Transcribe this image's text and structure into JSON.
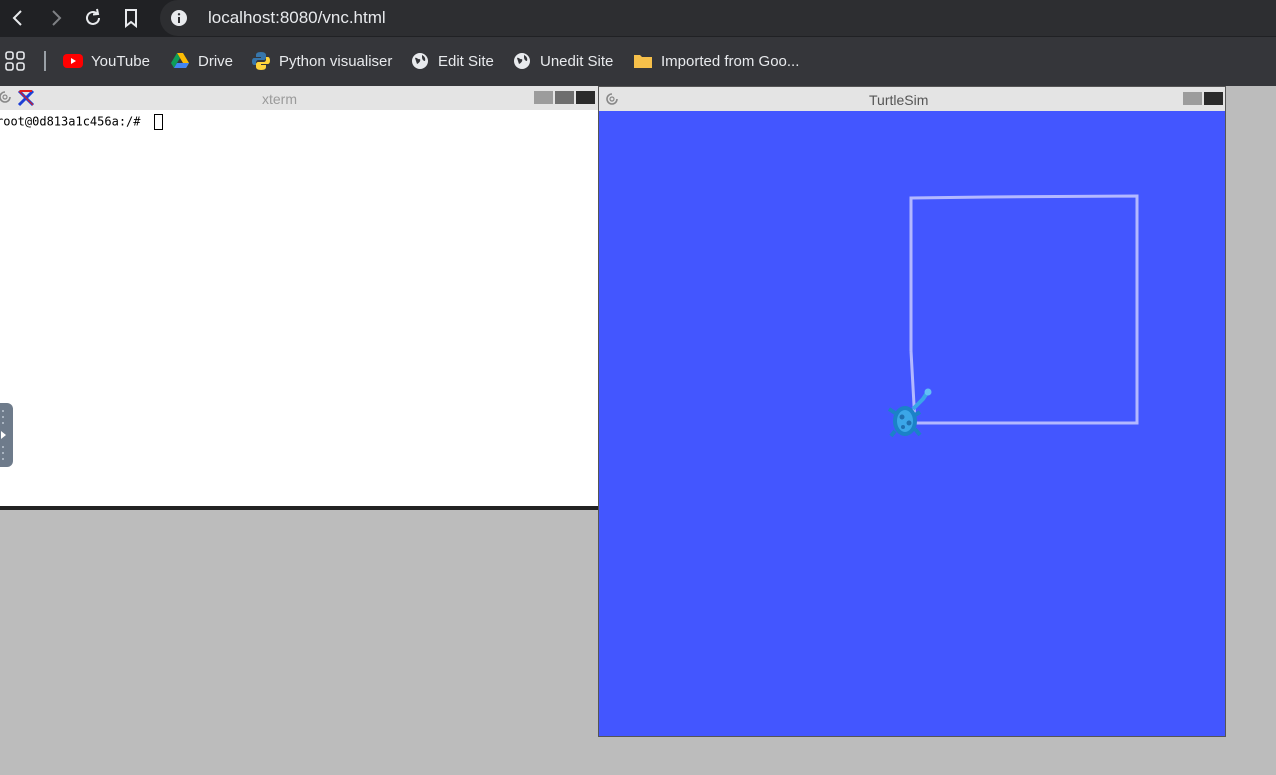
{
  "browser": {
    "url": "localhost:8080/vnc.html",
    "nav": {
      "back_icon": "chevron-left-icon",
      "forward_icon": "chevron-right-icon",
      "reload_icon": "reload-icon",
      "bookmark_icon": "bookmark-icon"
    },
    "bookmarks": [
      {
        "label": "YouTube",
        "icon": "youtube-icon"
      },
      {
        "label": "Drive",
        "icon": "drive-icon"
      },
      {
        "label": "Python visualiser",
        "icon": "python-icon"
      },
      {
        "label": "Edit Site",
        "icon": "globe-icon"
      },
      {
        "label": "Unedit Site",
        "icon": "globe-icon"
      },
      {
        "label": "Imported from Goo...",
        "icon": "folder-icon"
      }
    ]
  },
  "xterm": {
    "title": "xterm",
    "prompt": "root@0d813a1c456a:/# "
  },
  "turtlesim": {
    "title": "TurtleSim",
    "background_color": "#4356ff",
    "pen_color": "#b3b8ff"
  },
  "colors": {
    "chrome_bg": "#202124",
    "bookmark_bar": "#35363a",
    "desktop": "#bcbcbc"
  }
}
